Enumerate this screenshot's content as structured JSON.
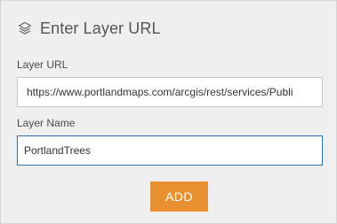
{
  "header": {
    "icon": "layers-icon",
    "title": "Enter Layer URL"
  },
  "form": {
    "url_label": "Layer URL",
    "url_value": "https://www.portlandmaps.com/arcgis/rest/services/Publi",
    "name_label": "Layer Name",
    "name_value": "PortlandTrees"
  },
  "actions": {
    "add_label": "ADD"
  },
  "colors": {
    "panel_bg": "#efefef",
    "accent": "#e8902f",
    "focus_border": "#2d6fa8"
  }
}
